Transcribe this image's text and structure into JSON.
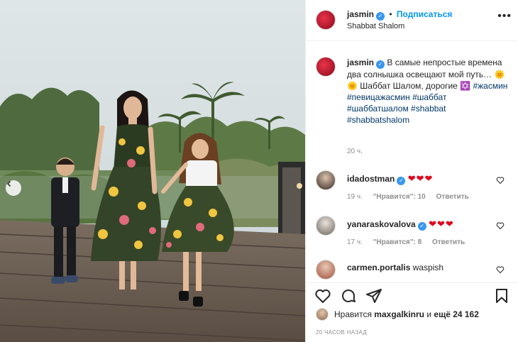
{
  "post": {
    "author": "jasmin",
    "follow_label": "Подписаться",
    "follow_separator": "•",
    "location": "Shabbat Shalom",
    "more_label": "•••",
    "caption_text": "В самые непростые времена два солнышка освещают мой путь… 🌞🌞 Шаббат Шалом, дорогие ✡️",
    "caption_tags": "#жасмин #певицажасмин #шаббат #шаббатшалом #shabbat #shabbatshalom",
    "caption_time": "20 ч.",
    "verified_mark": "✓"
  },
  "comments": [
    {
      "user": "idadostman",
      "text": "❤❤❤",
      "time": "19 ч.",
      "likes": "\"Нравится\": 10",
      "reply": "Ответить"
    },
    {
      "user": "yanaraskovalova",
      "text": "❤❤❤",
      "time": "17 ч.",
      "likes": "\"Нравится\": 8",
      "reply": "Ответить"
    },
    {
      "user": "carmen.portalis",
      "text": "waspish",
      "time": "",
      "likes": "",
      "reply": ""
    }
  ],
  "footer": {
    "likes_prefix": "Нравится",
    "likes_user": "maxgalkinru",
    "likes_and": "и",
    "likes_more": "ещё 24 162",
    "timestamp": "20 ЧАСОВ НАЗАД"
  },
  "icons": {
    "like": "heart-icon",
    "comment": "comment-icon",
    "share": "paper-plane-icon",
    "save": "bookmark-icon",
    "prev": "chevron-left-icon"
  },
  "colors": {
    "link_blue": "#0095f6",
    "verified_blue": "#3897f0",
    "tag_blue": "#00376b",
    "meta_gray": "#8e8e8e",
    "heart_red": "#e0001a"
  }
}
